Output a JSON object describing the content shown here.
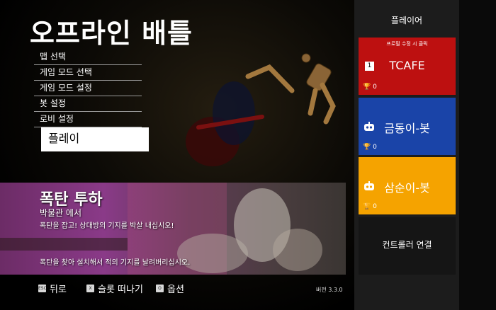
{
  "title": "오프라인 배틀",
  "menu": {
    "items": [
      "맵 선택",
      "게임 모드 선택",
      "게임 모드 설정",
      "봇 설정",
      "로비 설정"
    ],
    "selected": "플레이"
  },
  "banner": {
    "title": "폭탄 투하",
    "subtitle": "박물관 에서",
    "desc1": "폭탄을 잡고! 상대방의 기지를 박살 내십시오!",
    "desc2": "폭탄을 찾아 설치해서 적의 기지를 날려버리십시오."
  },
  "bottom": {
    "back_key": "ESC",
    "back_label": "뒤로",
    "slot_key": "X",
    "slot_label": "슬롯 떠나기",
    "options_key": "O",
    "options_label": "옵션",
    "version": "버전 3.3.0"
  },
  "panel": {
    "header": "플레이어",
    "profile_hint": "프로필 수정 시 클릭",
    "players": [
      {
        "name": "TCAFE",
        "badge": "1",
        "cups": "0",
        "color": "#bd1010"
      },
      {
        "name": "금동이-봇",
        "cups": "0",
        "color": "#1a44a8"
      },
      {
        "name": "삼순이-봇",
        "cups": "0",
        "color": "#f5a300"
      }
    ],
    "controller": "컨트롤러 연결"
  }
}
